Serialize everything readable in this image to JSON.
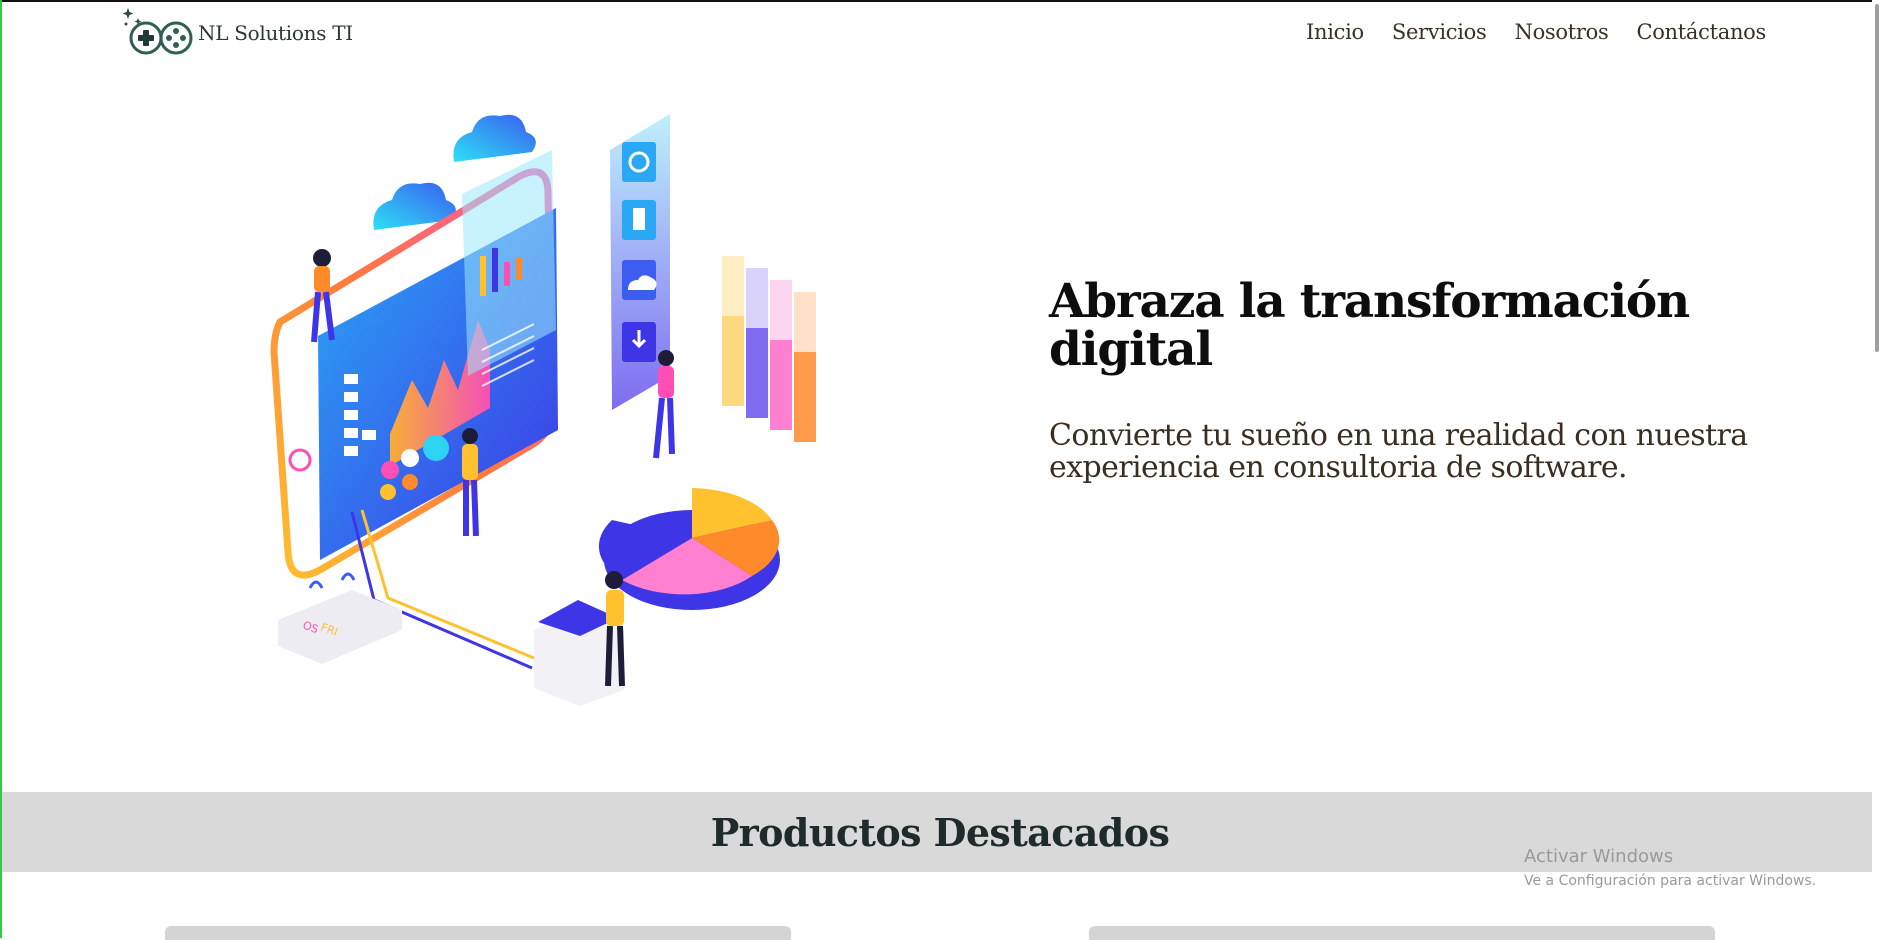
{
  "brand": {
    "name": "NL Solutions TI"
  },
  "nav": {
    "items": [
      {
        "label": "Inicio"
      },
      {
        "label": "Servicios"
      },
      {
        "label": "Nosotros"
      },
      {
        "label": "Contáctanos"
      }
    ]
  },
  "hero": {
    "title": "Abraza la transformación digital",
    "subtitle": "Convierte tu sueño en una realidad con nuestra experiencia en consultoria de software.",
    "illustration_labels": {
      "os": "OS",
      "fri": "FRI"
    }
  },
  "featured": {
    "heading": "Productos Destacados"
  },
  "watermark": {
    "title": "Activar Windows",
    "subtitle": "Ve a Configuración para activar Windows."
  },
  "colors": {
    "accent_green": "#2f5f50",
    "pink": "#ff4fb4",
    "orange": "#ff8a2a",
    "yellow": "#ffc12e",
    "blue": "#3b4cf0",
    "cyan": "#2dd3f2"
  }
}
